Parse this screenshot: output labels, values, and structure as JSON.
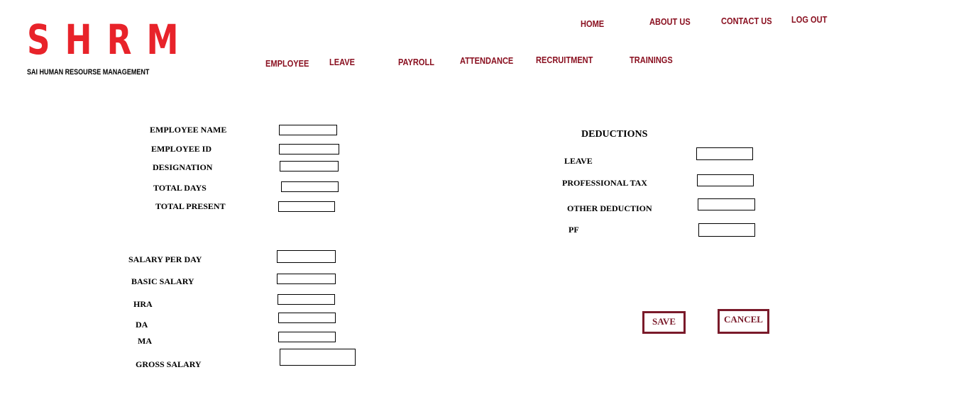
{
  "brand": {
    "logo": "SHRM",
    "tagline": "SAI HUMAN RESOURSE MANAGEMENT"
  },
  "top_nav": {
    "home": "HOME",
    "about": "ABOUT US",
    "contact": "CONTACT US",
    "logout": "LOG OUT"
  },
  "module_nav": {
    "employee": "EMPLOYEE",
    "leave": "LEAVE",
    "payroll": "PAYROLL",
    "attendance": "ATTENDANCE",
    "recruitment": "RECRUITMENT",
    "trainings": "TRAININGS"
  },
  "employee_fields": {
    "name": "EMPLOYEE NAME",
    "id": "EMPLOYEE ID",
    "designation": "DESIGNATION",
    "total_days": "TOTAL DAYS",
    "total_present": "TOTAL PRESENT"
  },
  "salary_fields": {
    "per_day": "SALARY PER  DAY",
    "basic": "BASIC SALARY",
    "hra": "HRA",
    "da": "DA",
    "ma": "MA",
    "gross": "GROSS SALARY"
  },
  "deductions": {
    "heading": "DEDUCTIONS",
    "leave": "LEAVE",
    "professional_tax": "PROFESSIONAL TAX",
    "other": "OTHER DEDUCTION",
    "pf": "PF"
  },
  "actions": {
    "save": "SAVE",
    "cancel": "CANCEL"
  },
  "colors": {
    "logo": "#e8232a",
    "nav": "#8a1020",
    "button_border": "#7a1a2a"
  }
}
